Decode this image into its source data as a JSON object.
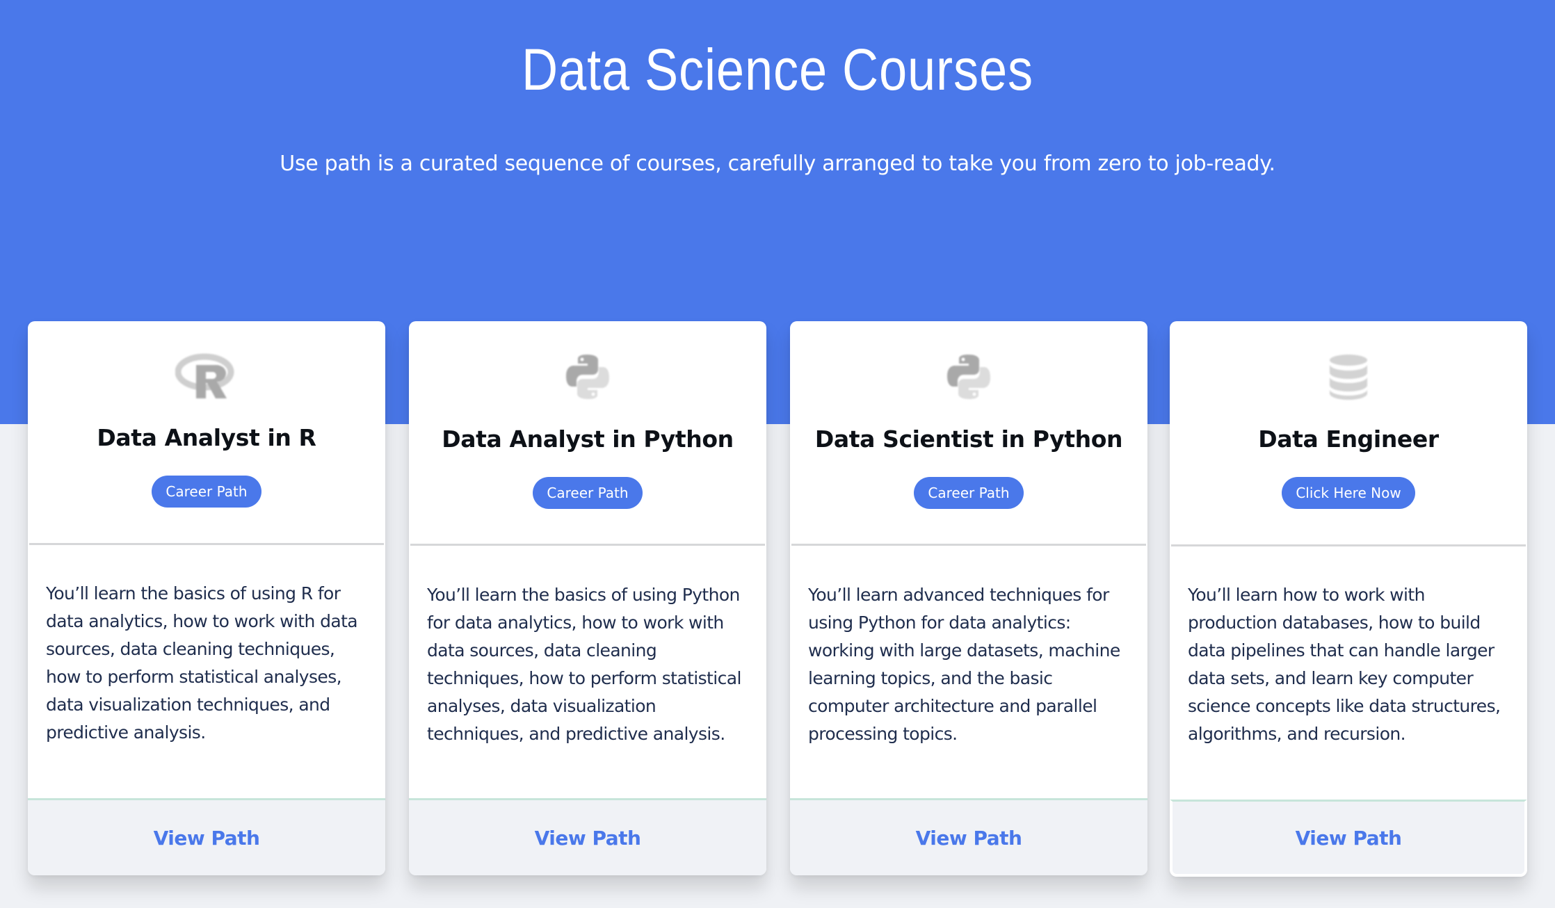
{
  "hero": {
    "title": "Data Science Courses",
    "subtitle": "Use path is a curated sequence of courses, carefully arranged to take you from zero to job-ready.",
    "background_color": "#4a78ea"
  },
  "cards": [
    {
      "icon": "r-logo-icon",
      "title": "Data Analyst in R",
      "badge": "Career Path",
      "description": "You’ll learn the basics of using R for data analytics, how to work with data sources, data cleaning techniques, how to perform statistical analyses, data visualization techniques, and predictive analysis.",
      "link": "View Path"
    },
    {
      "icon": "python-logo-icon",
      "title": "Data Analyst in Python",
      "badge": "Career Path",
      "description": "You’ll learn the basics of using Python for data analytics, how to work with data sources, data cleaning techniques, how to perform statistical analyses, data visualization techniques, and predictive analysis.",
      "link": "View Path"
    },
    {
      "icon": "python-logo-icon",
      "title": "Data Scientist in Python",
      "badge": "Career Path",
      "description": "You’ll learn advanced techniques for using Python for data analytics: working with large datasets, machine learning topics, and the basic computer architecture and parallel processing topics.",
      "link": "View Path"
    },
    {
      "icon": "database-icon",
      "title": "Data Engineer",
      "badge": "Click Here Now",
      "description": "You’ll learn how to work with production databases, how to build data pipelines that can handle larger data sets, and learn key computer science concepts like data structures, algorithms, and recursion.",
      "link": "View Path"
    }
  ],
  "colors": {
    "accent": "#4a78ea",
    "page_background": "#eff1f5",
    "footer_background": "#f0f2f6",
    "footer_border": "#c7e5da",
    "body_text": "#1f2d4d",
    "title_text": "#0d1117",
    "icon_gray": "#a8a8a8"
  }
}
